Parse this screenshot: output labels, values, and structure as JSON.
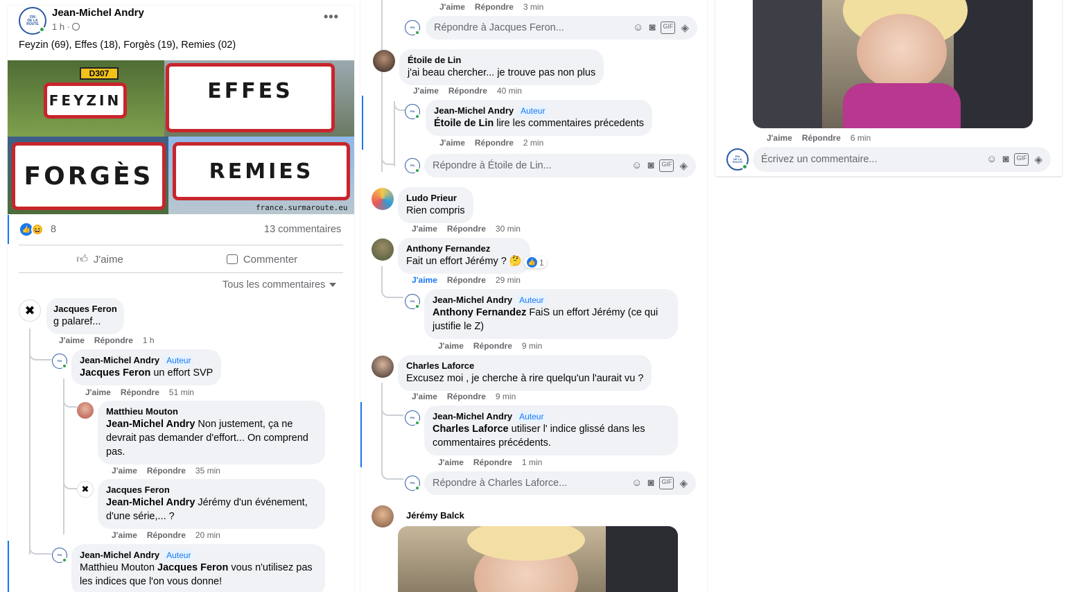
{
  "post": {
    "author": "Jean-Michel Andry",
    "time": "1 h ·",
    "privacy_icon": "globe-icon",
    "text": "Feyzin (69), Effes (18), Forgès (19), Remies (02)",
    "avatar_text": [
      "FIN",
      "DE LA",
      "ROUTE"
    ],
    "image": {
      "signs": [
        "FEYZIN",
        "EFFES",
        "FORGÈS",
        "REMIES"
      ],
      "route_plate": "D307",
      "watermark": "france.surmaroute.eu"
    },
    "reaction_count": "8",
    "comment_count": "13 commentaires",
    "like_label": "J'aime",
    "comment_label": "Commenter",
    "filter_label": "Tous les commentaires"
  },
  "labels": {
    "like": "J'aime",
    "reply": "Répondre",
    "author_badge": "Auteur"
  },
  "col1_comments": [
    {
      "name": "Jacques Feron",
      "text": "g palaref...",
      "time": "1 h"
    },
    {
      "name": "Jean-Michel Andry",
      "mention": "Jacques Feron",
      "text": " un effort SVP",
      "time": "51 min"
    },
    {
      "name": "Matthieu Mouton",
      "mention": "Jean-Michel Andry",
      "text": " Non justement, ça ne devrait pas demander d'effort... On comprend pas.",
      "time": "35 min"
    },
    {
      "name": "Jacques Feron",
      "mention": "Jean-Michel Andry",
      "text": " Jérémy d'un événement, d'une série,... ?",
      "time": "20 min"
    },
    {
      "name": "Jean-Michel Andry",
      "prefix": "Matthieu Mouton ",
      "mention": "Jacques Feron",
      "text": " vous n'utilisez pas les indices que l'on vous donne!"
    }
  ],
  "col2": {
    "top_actions_time": "3 min",
    "reply_jacques_placeholder": "Répondre à Jacques Feron...",
    "etoile": {
      "name": "Étoile de Lin",
      "text": "j'ai beau chercher... je trouve pas non plus",
      "time": "40 min"
    },
    "jma_etoile": {
      "name": "Jean-Michel Andry",
      "mention": "Étoile de Lin",
      "text": " lire les commentaires précedents",
      "time": "2 min"
    },
    "reply_etoile_placeholder": "Répondre à Étoile de Lin...",
    "ludo": {
      "name": "Ludo Prieur",
      "text": "Rien compris",
      "time": "30 min"
    },
    "anthony": {
      "name": "Anthony Fernandez",
      "text": "Fait un effort Jérémy ? 🤔",
      "reaction_count": "1",
      "time": "29 min"
    },
    "jma_anthony": {
      "name": "Jean-Michel Andry",
      "mention": "Anthony Fernandez",
      "text": " FaiS un effort Jérémy (ce qui justifie le Z)",
      "time": "9 min"
    },
    "charles": {
      "name": "Charles Laforce",
      "text": "Excusez moi , je cherche à rire quelqu'un l'aurait vu ?",
      "time": "9 min"
    },
    "jma_charles": {
      "name": "Jean-Michel Andry",
      "mention": "Charles Laforce",
      "text": " utiliser l' indice glissé dans les commentaires précédents.",
      "time": "1 min"
    },
    "reply_charles_placeholder": "Répondre à Charles Laforce...",
    "jeremy": {
      "name": "Jérémy Balck"
    }
  },
  "col3": {
    "time": "6 min",
    "write_placeholder": "Écrivez un commentaire..."
  },
  "icons": {
    "input_icons": [
      "smiley-icon",
      "camera-icon",
      "gif-icon",
      "sticker-icon"
    ]
  },
  "colors": {
    "accent": "#1877f2",
    "bubble": "#f0f2f5",
    "meta": "#65676b",
    "online": "#31a24c",
    "sign_border": "#c8252c"
  }
}
